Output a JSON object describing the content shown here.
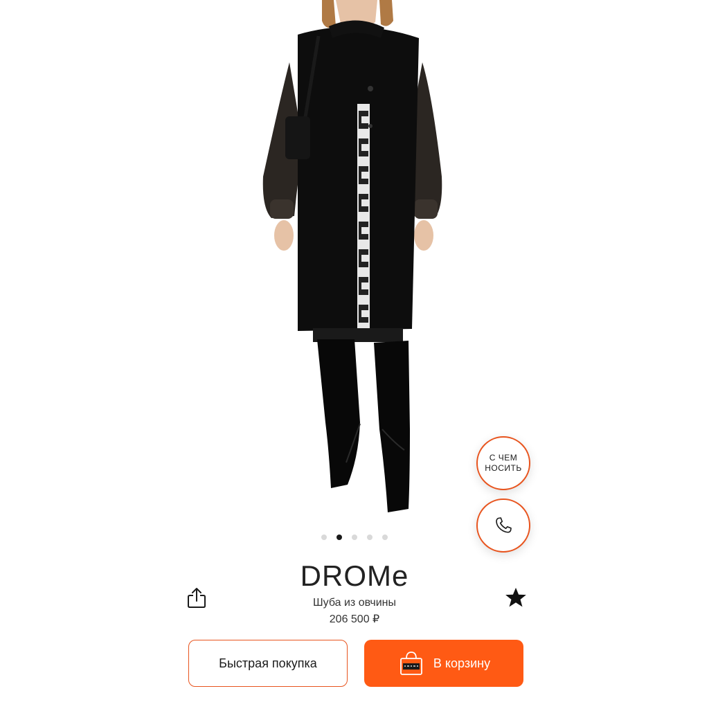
{
  "product": {
    "brand": "DROMe",
    "subtitle": "Шуба из овчины",
    "price": "206 500 ₽",
    "gallery": {
      "total": 5,
      "active": 2
    }
  },
  "fab": {
    "wear_label": "С ЧЕМ\nНОСИТЬ",
    "call_icon": "phone-icon"
  },
  "actions": {
    "quick_buy_label": "Быстрая покупка",
    "cart_label": "В корзину",
    "share_icon": "share-icon",
    "favorite_icon": "star-icon"
  },
  "colors": {
    "accent": "#ff5a14",
    "border_accent": "#e8541e"
  }
}
